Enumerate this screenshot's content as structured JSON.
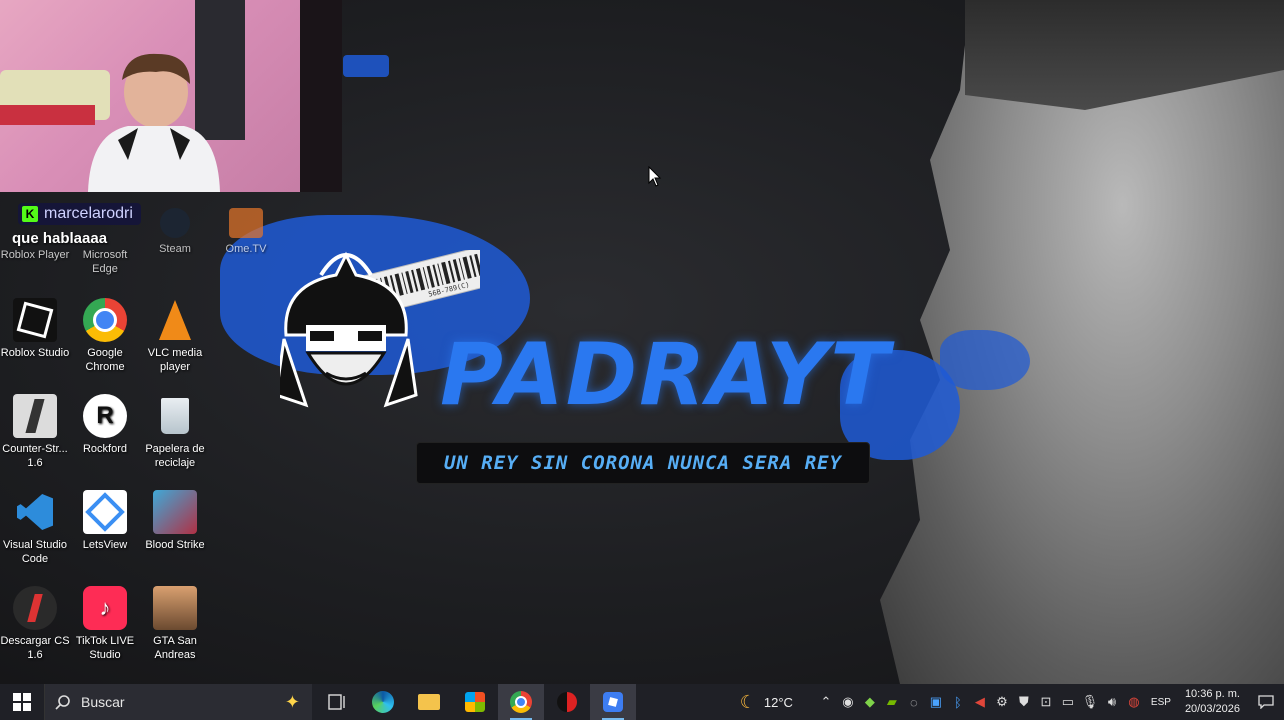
{
  "wallpaper": {
    "brand_title": "PADRAYT",
    "slogan": "UN REY SIN CORONA NUNCA SERA REY",
    "barcode_text": "56B-789(C)"
  },
  "chat": {
    "username": "marcelarodri",
    "message": "que hablaaaa",
    "badge": "K"
  },
  "desktop_icons_top_row": [
    {
      "label": "Roblox Player"
    },
    {
      "label": "Microsoft Edge"
    },
    {
      "label": "Steam"
    },
    {
      "label": "Ome.TV"
    }
  ],
  "desktop_icons": [
    {
      "label": "Roblox Studio",
      "icon": "roblox-studio-icon"
    },
    {
      "label": "Google Chrome",
      "icon": "chrome-icon"
    },
    {
      "label": "VLC media player",
      "icon": "vlc-icon"
    },
    {
      "label": "Counter-Str... 1.6",
      "icon": "counter-strike-icon"
    },
    {
      "label": "Rockford",
      "icon": "rockford-icon"
    },
    {
      "label": "Papelera de reciclaje",
      "icon": "recycle-bin-icon"
    },
    {
      "label": "Visual Studio Code",
      "icon": "vscode-icon"
    },
    {
      "label": "LetsView",
      "icon": "letsview-icon"
    },
    {
      "label": "Blood Strike",
      "icon": "blood-strike-icon"
    },
    {
      "label": "Descargar CS 1.6",
      "icon": "cs-download-icon"
    },
    {
      "label": "TikTok LIVE Studio",
      "icon": "tiktok-icon"
    },
    {
      "label": "GTA San Andreas",
      "icon": "gta-icon"
    }
  ],
  "taskbar": {
    "search_placeholder": "Buscar",
    "apps": [
      "task-view-icon",
      "edge-icon",
      "file-explorer-icon",
      "store-icon",
      "chrome-icon",
      "media-app-icon",
      "roblox-icon"
    ],
    "weather_temp": "12°C",
    "language": "ESP",
    "time": "10:36 p. m.",
    "date": "20/03/2026"
  },
  "colors": {
    "accent_blue": "#2a78f0",
    "slogan_blue": "#57aef5",
    "taskbar_bg": "#1f2026"
  }
}
